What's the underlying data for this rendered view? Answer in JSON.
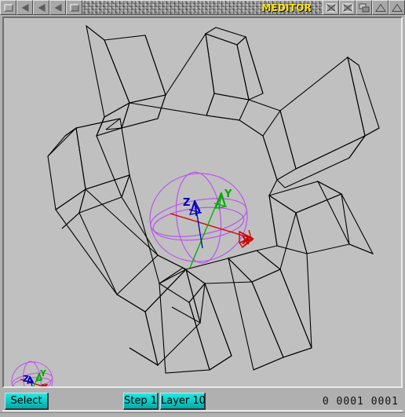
{
  "window": {
    "title": "MEDITOR",
    "title_color": "#ffe600",
    "bg_color": "#b0b0b0",
    "viewport_bg_color": "#c0c0c0"
  },
  "titlebar": {
    "left_buttons": [
      {
        "name": "close-button",
        "icon": "close-box-icon",
        "label": ""
      },
      {
        "name": "prev-view-button",
        "icon": "triangle-left-icon",
        "label": ""
      },
      {
        "name": "prev-frame-button",
        "icon": "triangle-left-icon",
        "label": ""
      },
      {
        "name": "prev-step-button",
        "icon": "triangle-left-icon",
        "label": ""
      },
      {
        "name": "maximize-button",
        "icon": "square-box-icon",
        "label": ""
      }
    ],
    "right_buttons": [
      {
        "name": "snapshot-button",
        "icon": "cross-box-icon",
        "label": ""
      },
      {
        "name": "unsnapshot-button",
        "icon": "cross-box-icon",
        "label": ""
      },
      {
        "name": "depth-cycle-button",
        "icon": "depth-arrange-icon",
        "label": ""
      },
      {
        "name": "zoom-button",
        "icon": "triangle-up-icon",
        "label": ""
      },
      {
        "name": "front-button",
        "icon": "triangle-up-icon",
        "label": ""
      }
    ]
  },
  "toolbar": {
    "select_label": "Select",
    "step_label": "Step 1",
    "layer_label": "Layer 10",
    "button_color": "#12cfca"
  },
  "status": {
    "coords": "0  0001  0001"
  },
  "viewport": {
    "model_name": "gear-wireframe",
    "wireframe_color": "#000000",
    "gizmo": {
      "ring_color": "#bb55ee",
      "axis_x_color": "#cc0000",
      "axis_y_color": "#00aa00",
      "axis_z_color": "#0000bb",
      "axis_labels": {
        "x": "X",
        "y": "Y",
        "z": "Z"
      }
    }
  }
}
